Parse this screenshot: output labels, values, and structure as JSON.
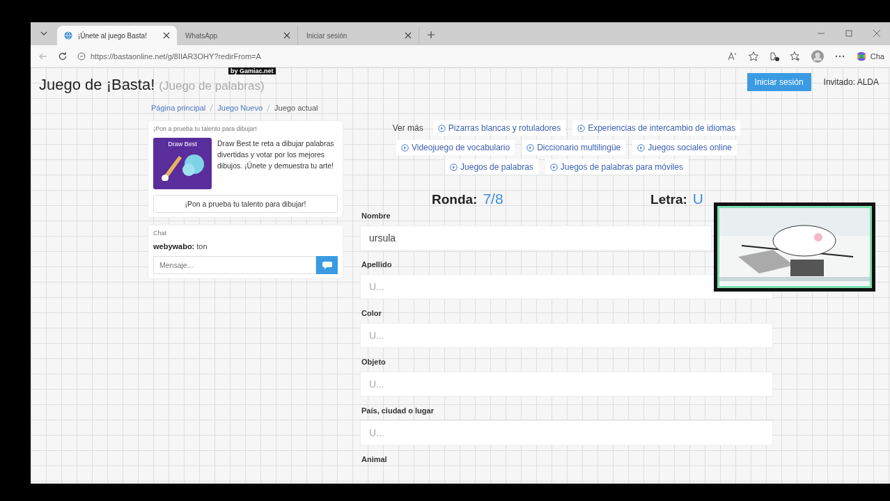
{
  "browser": {
    "tabs": [
      {
        "title": "¡Únete al juego Basta!",
        "selected": true
      },
      {
        "title": "WhatsApp",
        "selected": false
      },
      {
        "title": "Iniciar sesión",
        "selected": false
      }
    ],
    "url": "https://bastaonline.net/g/8IIAR3OHY?redirFrom=A",
    "copilot_label": "Cha"
  },
  "header": {
    "title": "Juego de ¡Basta!",
    "subtitle": "(Juego de palabras)",
    "badge": "by Gamiac.net",
    "login_button": "Iniciar sesión",
    "guest": "Invitado: ALDA"
  },
  "breadcrumb": [
    {
      "label": "Página principal",
      "kind": "link"
    },
    {
      "label": "Juego Nuevo",
      "kind": "link"
    },
    {
      "label": "Juego actual",
      "kind": "current"
    }
  ],
  "promo": {
    "heading": "¡Pon a prueba tu talento para dibujar!",
    "image_title": "Draw Best",
    "text": "Draw Best te reta a dibujar palabras divertidas y votar por los mejores dibujos. ¡Únete y demuestra tu arte!",
    "button": "¡Pon a prueba tu talento para dibujar!"
  },
  "chat": {
    "heading": "Chat",
    "messages": [
      {
        "user": "webywabo:",
        "text": "ton"
      }
    ],
    "placeholder": "Mensaje..."
  },
  "see_more": {
    "label": "Ver más",
    "rows": [
      [
        "Pizarras blancas y rotuladores",
        "Experiencias de intercambio de idiomas"
      ],
      [
        "Videojuego de vocabulario",
        "Diccionario multilingüe",
        "Juegos sociales online"
      ],
      [
        "Juegos de palabras",
        "Juegos de palabras para móviles"
      ]
    ]
  },
  "status": {
    "round_label": "Ronda:",
    "round": "7/8",
    "letter_label": "Letra:",
    "letter": "U"
  },
  "fields": [
    {
      "label": "Nombre",
      "value": "ursula"
    },
    {
      "label": "Apellido",
      "placeholder": "U..."
    },
    {
      "label": "Color",
      "placeholder": "U..."
    },
    {
      "label": "Objeto",
      "placeholder": "U..."
    },
    {
      "label": "País, ciudad o lugar",
      "placeholder": "U..."
    },
    {
      "label": "Animal"
    }
  ]
}
